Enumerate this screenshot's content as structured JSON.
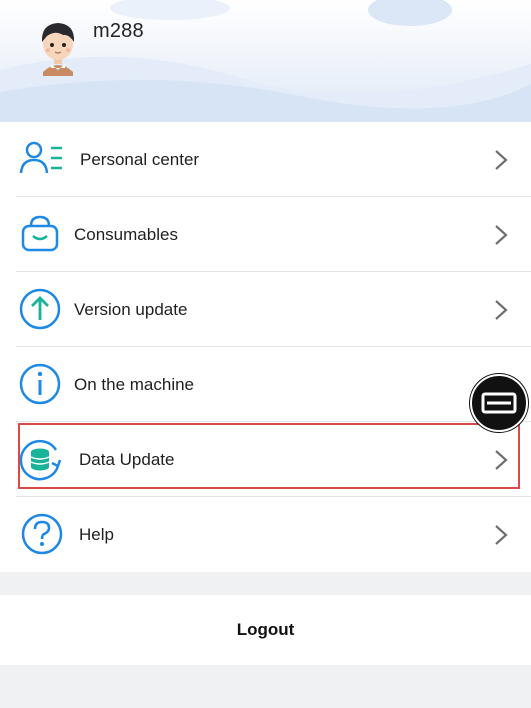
{
  "profile": {
    "username": "m288"
  },
  "menu": {
    "items": [
      {
        "label": "Personal center",
        "icon": "person-list-icon"
      },
      {
        "label": "Consumables",
        "icon": "basket-icon"
      },
      {
        "label": "Version update",
        "icon": "arrow-up-circle-icon"
      },
      {
        "label": "On the machine",
        "icon": "info-circle-icon"
      },
      {
        "label": "Data Update",
        "icon": "database-refresh-icon"
      },
      {
        "label": "Help",
        "icon": "question-circle-icon"
      }
    ]
  },
  "logout": {
    "label": "Logout"
  },
  "colors": {
    "accent": "#1e88e5",
    "teal": "#19b39a",
    "highlight": "#e04848"
  }
}
